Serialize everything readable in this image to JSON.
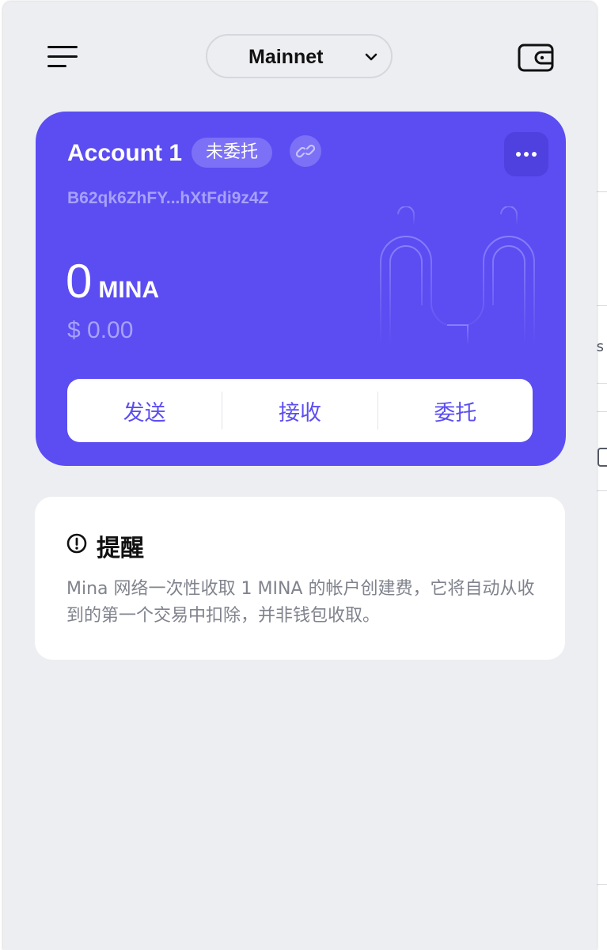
{
  "header": {
    "network": "Mainnet"
  },
  "account": {
    "name": "Account 1",
    "delegation_status": "未委托",
    "address": "B62qk6ZhFY...hXtFdi9z4Z",
    "balance": "0",
    "balance_unit": "MINA",
    "fiat_value": "$ 0.00"
  },
  "actions": {
    "send": "发送",
    "receive": "接收",
    "delegate": "委托"
  },
  "notice": {
    "title": "提醒",
    "body": "Mina 网络一次性收取 1 MINA 的帐户创建费，它将自动从收到的第一个交易中扣除，并非钱包收取。"
  },
  "colors": {
    "accent": "#5b4df2",
    "background": "#edeef2"
  },
  "background_page": {
    "edge_text": "s"
  }
}
